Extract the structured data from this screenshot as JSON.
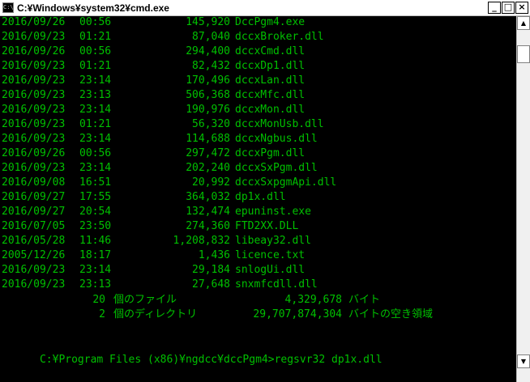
{
  "window": {
    "title": "C:¥Windows¥system32¥cmd.exe",
    "app_icon_text": "C:\\",
    "minimize_glyph": "_",
    "maximize_glyph": "□",
    "close_glyph": "×",
    "scroll_up_glyph": "▲",
    "scroll_down_glyph": "▼"
  },
  "colors": {
    "console_background": "#000000",
    "console_text": "#00c000",
    "titlebar": "#ffffff"
  },
  "listing": [
    {
      "date": "2016/09/26",
      "time": "00:56",
      "size": "145,920",
      "name": "DccPgm4.exe"
    },
    {
      "date": "2016/09/23",
      "time": "01:21",
      "size": "87,040",
      "name": "dccxBroker.dll"
    },
    {
      "date": "2016/09/26",
      "time": "00:56",
      "size": "294,400",
      "name": "dccxCmd.dll"
    },
    {
      "date": "2016/09/23",
      "time": "01:21",
      "size": "82,432",
      "name": "dccxDp1.dll"
    },
    {
      "date": "2016/09/23",
      "time": "23:14",
      "size": "170,496",
      "name": "dccxLan.dll"
    },
    {
      "date": "2016/09/23",
      "time": "23:13",
      "size": "506,368",
      "name": "dccxMfc.dll"
    },
    {
      "date": "2016/09/23",
      "time": "23:14",
      "size": "190,976",
      "name": "dccxMon.dll"
    },
    {
      "date": "2016/09/23",
      "time": "01:21",
      "size": "56,320",
      "name": "dccxMonUsb.dll"
    },
    {
      "date": "2016/09/23",
      "time": "23:14",
      "size": "114,688",
      "name": "dccxNgbus.dll"
    },
    {
      "date": "2016/09/26",
      "time": "00:56",
      "size": "297,472",
      "name": "dccxPgm.dll"
    },
    {
      "date": "2016/09/23",
      "time": "23:14",
      "size": "202,240",
      "name": "dccxSxPgm.dll"
    },
    {
      "date": "2016/09/08",
      "time": "16:51",
      "size": "20,992",
      "name": "dccxSxpgmApi.dll"
    },
    {
      "date": "2016/09/27",
      "time": "17:55",
      "size": "364,032",
      "name": "dp1x.dll"
    },
    {
      "date": "2016/09/27",
      "time": "20:54",
      "size": "132,474",
      "name": "epuninst.exe"
    },
    {
      "date": "2016/07/05",
      "time": "23:50",
      "size": "274,360",
      "name": "FTD2XX.DLL"
    },
    {
      "date": "2016/05/28",
      "time": "11:46",
      "size": "1,208,832",
      "name": "libeay32.dll"
    },
    {
      "date": "2005/12/26",
      "time": "18:17",
      "size": "1,436",
      "name": "licence.txt"
    },
    {
      "date": "2016/09/23",
      "time": "23:14",
      "size": "29,184",
      "name": "snlogUi.dll"
    },
    {
      "date": "2016/09/23",
      "time": "23:13",
      "size": "27,648",
      "name": "snxmfcdll.dll"
    }
  ],
  "summary": {
    "files_count": "20",
    "files_label": "個のファイル",
    "files_bytes": "4,329,678",
    "files_unit": "バイト",
    "dirs_count": "2",
    "dirs_label": "個のディレクトリ",
    "dirs_bytes": "29,707,874,304",
    "dirs_unit": "バイトの空き領域"
  },
  "prompt": {
    "path": "C:¥Program Files (x86)¥ngdcc¥dccPgm4>",
    "command": "regsvr32 dp1x.dll"
  }
}
